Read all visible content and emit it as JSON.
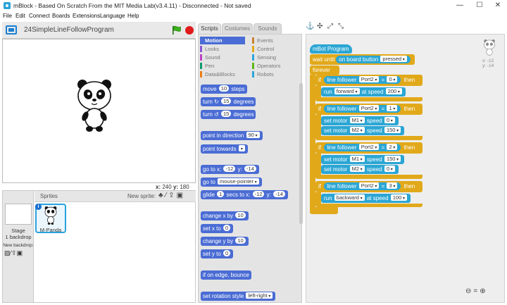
{
  "window": {
    "title": "mBlock - Based On Scratch From the MIT Media Lab(v3.4.11) - Disconnected - Not saved",
    "minimize": "—",
    "maximize": "☐",
    "close": "✕"
  },
  "menu": [
    "File",
    "Edit",
    "Connect",
    "Boards",
    "Extensions",
    "Language",
    "Help"
  ],
  "stage": {
    "project_name": "24SimpleLineFollowProgram",
    "x_label": "x:",
    "x_value": "240",
    "y_label": "y:",
    "y_value": "180"
  },
  "sprites": {
    "title": "Sprites",
    "new_sprite_label": "New sprite:",
    "stage_label": "Stage",
    "backdrop_count": "1 backdrop",
    "new_backdrop_label": "New backdrop:",
    "sprite_name": "M-Panda",
    "info": "i"
  },
  "tabs": [
    "Scripts",
    "Costumes",
    "Sounds"
  ],
  "categories": {
    "left": [
      {
        "label": "Motion",
        "color": "#4a6cd4"
      },
      {
        "label": "Looks",
        "color": "#8a55d7"
      },
      {
        "label": "Sound",
        "color": "#bb42c3"
      },
      {
        "label": "Pen",
        "color": "#0e9a6c"
      },
      {
        "label": "Data&Blocks",
        "color": "#ee7d16"
      }
    ],
    "right": [
      {
        "label": "Events",
        "color": "#c88330"
      },
      {
        "label": "Control",
        "color": "#e1a91a"
      },
      {
        "label": "Sensing",
        "color": "#2ca5e2"
      },
      {
        "label": "Operators",
        "color": "#5cb712"
      },
      {
        "label": "Robots",
        "color": "#2ba6d4"
      }
    ]
  },
  "palette": {
    "move": {
      "pre": "move",
      "val": "10",
      "post": "steps"
    },
    "turn_cw": {
      "pre": "turn ↻",
      "val": "15",
      "post": "degrees"
    },
    "turn_ccw": {
      "pre": "turn ↺",
      "val": "15",
      "post": "degrees"
    },
    "point_dir": {
      "pre": "point in direction",
      "val": "90"
    },
    "point_towards": {
      "pre": "point towards",
      "val": ""
    },
    "goto_xy": {
      "pre": "go to x:",
      "x": "-12",
      "mid": "y:",
      "y": "-14"
    },
    "goto": {
      "pre": "go to",
      "val": "mouse-pointer"
    },
    "glide": {
      "pre": "glide",
      "secs": "1",
      "mid1": "secs to x:",
      "x": "-12",
      "mid2": "y:",
      "y": "-14"
    },
    "change_x": {
      "pre": "change x by",
      "val": "10"
    },
    "set_x": {
      "pre": "set x to",
      "val": "0"
    },
    "change_y": {
      "pre": "change y by",
      "val": "10"
    },
    "set_y": {
      "pre": "set y to",
      "val": "0"
    },
    "bounce": {
      "label": "if on edge, bounce"
    },
    "rotation": {
      "pre": "set rotation style",
      "val": "left-right"
    }
  },
  "script": {
    "hat": "mBot Program",
    "wait": {
      "pre": "wait until",
      "cond_pre": "on board button",
      "val": "pressed"
    },
    "forever": "forever",
    "if_kw": "if",
    "then_kw": "then",
    "line_follower_label": "line follower",
    "port": "Port2",
    "eq": "=",
    "set_motor_label": "set motor",
    "speed_label": "speed",
    "at_speed_label": "at speed",
    "branches": [
      {
        "cond_val": "0",
        "actions": [
          {
            "kind": "run",
            "dir": "forward",
            "speed": "200"
          }
        ]
      },
      {
        "cond_val": "1",
        "actions": [
          {
            "kind": "motor",
            "motor": "M1",
            "speed": "0"
          },
          {
            "kind": "motor",
            "motor": "M2",
            "speed": "150"
          }
        ]
      },
      {
        "cond_val": "2",
        "actions": [
          {
            "kind": "motor",
            "motor": "M1",
            "speed": "150"
          },
          {
            "kind": "motor",
            "motor": "M2",
            "speed": "0"
          }
        ]
      },
      {
        "cond_val": "3",
        "actions": [
          {
            "kind": "run",
            "dir": "backward",
            "speed": "100"
          }
        ]
      }
    ],
    "run_label": "run"
  },
  "sprite_pos": {
    "x": "x: -12",
    "y": "y: -14"
  }
}
